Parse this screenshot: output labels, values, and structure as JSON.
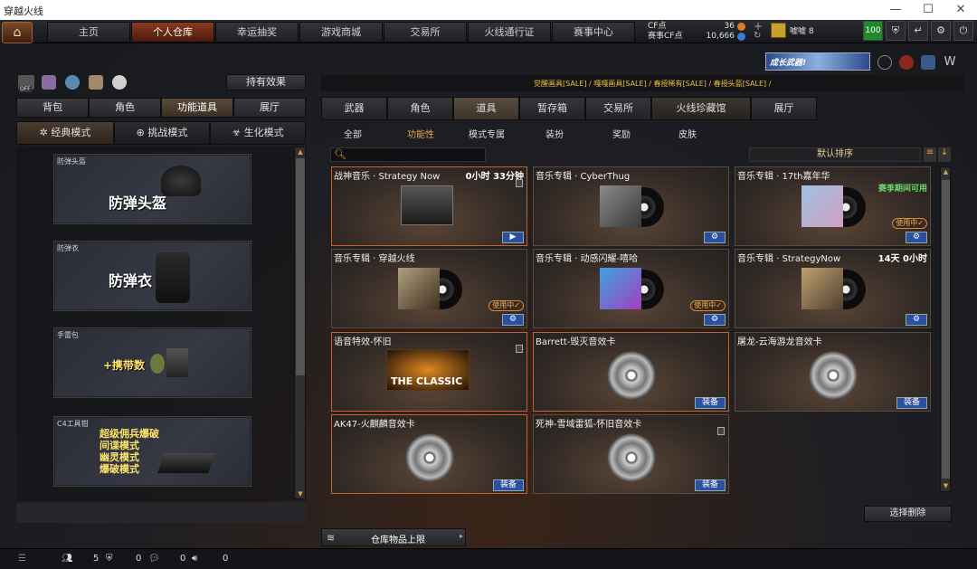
{
  "window": {
    "title": "穿越火线",
    "min": "—",
    "max": "☐",
    "close": "✕"
  },
  "nav": {
    "tabs": [
      "主页",
      "个人仓库",
      "幸运抽奖",
      "游戏商城",
      "交易所",
      "火线通行证",
      "赛事中心"
    ],
    "cf_label": "CF点",
    "cf_value": "36",
    "match_cf_label": "赛事CF点",
    "match_cf_value": "10,666",
    "plus": "+",
    "rank_text": "嘘嘘 8",
    "level": "100"
  },
  "banner": {
    "text": "成长武器!"
  },
  "left": {
    "effects_btn": "持有效果",
    "off_badge": "OFF",
    "tabs": [
      "背包",
      "角色",
      "功能道具",
      "展厅"
    ],
    "modes": [
      "经典模式",
      "挑战模式",
      "生化模式"
    ],
    "items": [
      {
        "cap": "防弹头盔",
        "big": "防弹头盔"
      },
      {
        "cap": "防弹衣",
        "big": "防弹衣"
      },
      {
        "cap": "手雷包",
        "big": "+携带数"
      },
      {
        "cap": "C4工具钳",
        "lines": [
          "超级佣兵爆破",
          "间谍模式",
          "幽灵模式",
          "爆破模式"
        ]
      }
    ]
  },
  "right": {
    "ticker": "觉醒画具[SALE] / 嘎嘎画具[SALE] / 春授稀有[SALE] / 春授头盔[SALE] /",
    "tabs": [
      "武器",
      "角色",
      "道具",
      "暂存箱",
      "交易所",
      "火线珍藏馆",
      "展厅"
    ],
    "subtabs": [
      "全部",
      "功能性",
      "模式专属",
      "装扮",
      "奖励",
      "皮肤"
    ],
    "sort": "默认排序",
    "inuse_label": "使用中✓",
    "equip_label": "装备",
    "cards": [
      {
        "name": "战神音乐 · Strategy Now",
        "time": "0小时 33分钟"
      },
      {
        "name": "音乐专辑 · CyberThug"
      },
      {
        "name": "音乐专辑 · 17th嘉年华",
        "season": "赛季期间可用"
      },
      {
        "name": "音乐专辑 · 穿越火线"
      },
      {
        "name": "音乐专辑 · 动感闪耀-嘻哈"
      },
      {
        "name": "音乐专辑 · StrategyNow",
        "time": "14天 0小时"
      },
      {
        "name": "语音特效-怀旧",
        "cover_text": "THE CLASSIC"
      },
      {
        "name": "Barrett-毁灭音效卡"
      },
      {
        "name": "屠龙-云海游龙音效卡"
      },
      {
        "name": "AK47-火麒麟音效卡"
      },
      {
        "name": "死神-雪域雷狐-怀旧音效卡"
      }
    ],
    "select_delete": "选择删除",
    "storage_limit": "仓库物品上限"
  },
  "bottom": {
    "count1": "5",
    "count2": "0",
    "count3": "0",
    "count4": "0"
  }
}
